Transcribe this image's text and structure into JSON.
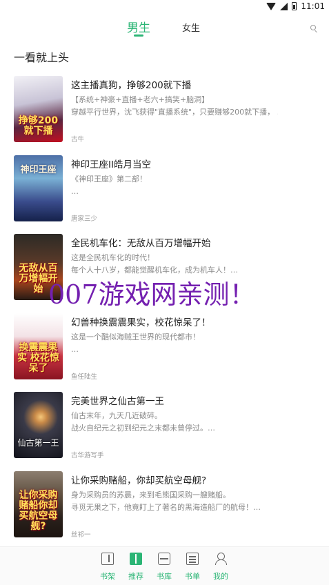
{
  "status_bar": {
    "time": "11:01"
  },
  "tabs": {
    "male": "男生",
    "female": "女生"
  },
  "section_title": "一看就上头",
  "books": [
    {
      "title": "这主播真狗，挣够200就下播",
      "desc_lines": [
        "【系统+神豪+直播+老六+搞笑+脑洞】",
        "穿越平行世界，沈飞获得\"直播系统\"，只要赚够200就下播， …"
      ],
      "author": "古牛",
      "cover_text": "挣够200就下播"
    },
    {
      "title": "神印王座II皓月当空",
      "desc_lines": [
        "《神印王座》第二部！",
        "…"
      ],
      "author": "唐家三少",
      "cover_text": "神印王座"
    },
    {
      "title": "全民机车化：无敌从百万增幅开始",
      "desc_lines": [
        "这是全民机车化的时代！",
        "每个人十八岁，都能觉醒机车化，成为机车人！…"
      ],
      "author": "",
      "cover_text": "无敌从百万增幅开始"
    },
    {
      "title": "幻兽种换震震果实，校花惊呆了！",
      "desc_lines": [
        "这是一个酷似海贼王世界的现代都市！",
        "…"
      ],
      "author": "鱼任陆生",
      "cover_text": "换震震果实 校花惊呆了"
    },
    {
      "title": "完美世界之仙古第一王",
      "desc_lines": [
        "仙古末年，九天几近破碎。",
        "战火自纪元之初到纪元之末都未曾停过。…"
      ],
      "author": "古华游写手",
      "cover_text": "仙古第一王"
    },
    {
      "title": "让你采购赌船，你却买航空母舰?",
      "desc_lines": [
        "身为采购员的苏晨，来到毛熊国采购一艘赌船。",
        "寻觅无果之下，他竟盯上了著名的黑海造船厂的航母！…"
      ],
      "author": "丝祁一",
      "cover_text": "让你采购赌船你却买航空母舰?"
    }
  ],
  "watermark": "007游戏网亲测！",
  "bottom_nav": [
    "书架",
    "推荐",
    "书库",
    "书单",
    "我的"
  ],
  "colors": {
    "accent": "#2bb575",
    "watermark": "#7420b0"
  }
}
